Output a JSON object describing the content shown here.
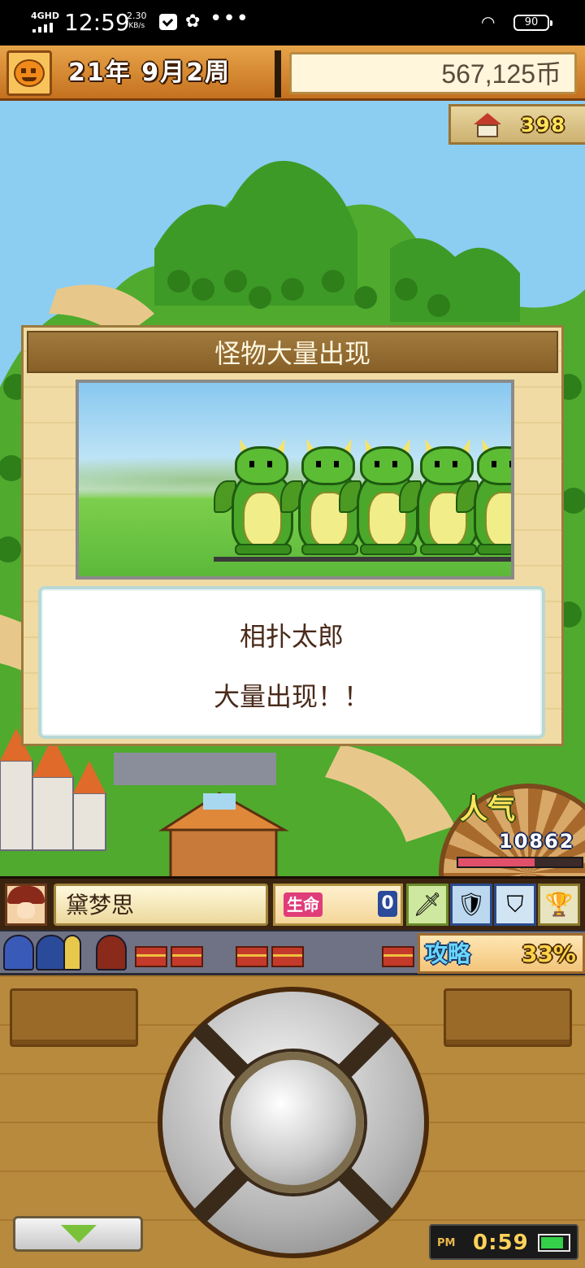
{
  "status_bar": {
    "network": "4GHD",
    "time": "12:59",
    "speed_value": "2.30",
    "speed_unit": "KB/s",
    "more": "•••",
    "battery": "90"
  },
  "hud": {
    "date": "21年 9月2周",
    "money": "567,125币",
    "population": "398"
  },
  "dialog": {
    "title": "怪物大量出现",
    "monster_name": "相扑太郎",
    "message": "大量出现！！"
  },
  "popularity": {
    "label": "人气",
    "value": "10862",
    "bar_fraction": 0.62,
    "bar_color": "#e0506a"
  },
  "character": {
    "name": "黛梦思",
    "life_label": "生命",
    "life_value": "0",
    "equipment_icons": [
      "sword-icon",
      "armor-icon",
      "shield-icon",
      "trophy-icon"
    ]
  },
  "strategy": {
    "label": "攻略",
    "value": "33%"
  },
  "controller": {
    "ampm": "PM",
    "clock": "0:59",
    "battery_fraction": 0.85,
    "battery_color": "#34d04a"
  }
}
